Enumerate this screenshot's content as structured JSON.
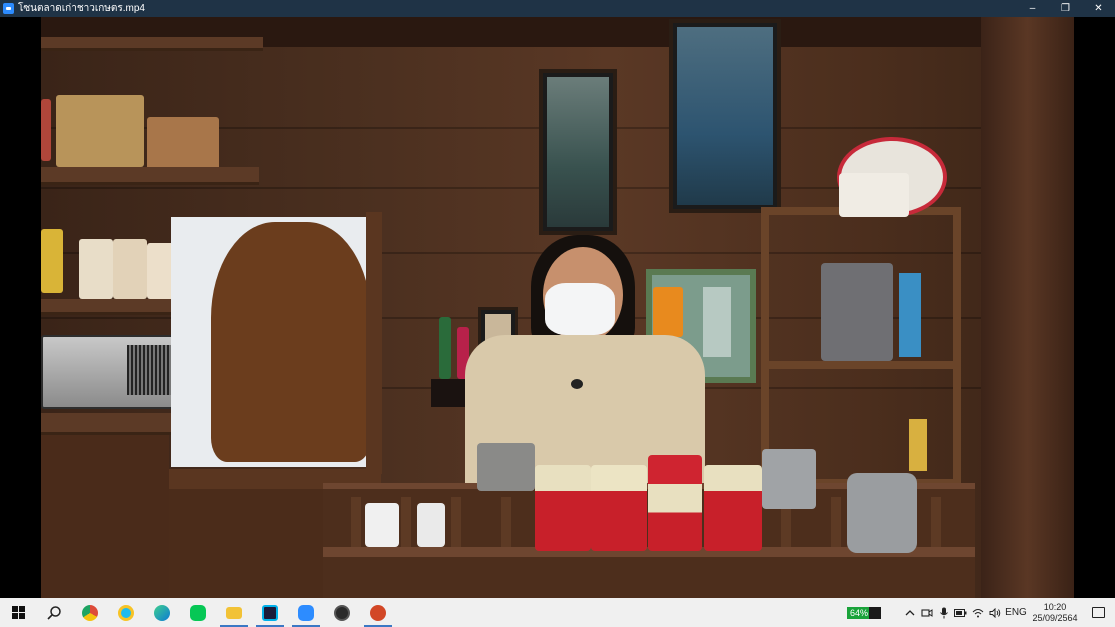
{
  "window": {
    "title": "โซนตลาดเก่าชาวเกษตร.mp4",
    "minimize_glyph": "–",
    "restore_glyph": "❐",
    "close_glyph": "✕"
  },
  "taskbar": {
    "apps": [
      {
        "name": "search-icon"
      },
      {
        "name": "chrome-icon",
        "color": "#dd4b39"
      },
      {
        "name": "internet-explorer-icon",
        "color": "#1ebbee"
      },
      {
        "name": "edge-icon",
        "color": "#0c7bd4"
      },
      {
        "name": "line-icon",
        "color": "#06c755"
      },
      {
        "name": "file-explorer-icon",
        "color": "#f2c236"
      },
      {
        "name": "webex-icon",
        "color": "#1a1a3a"
      },
      {
        "name": "zoom-icon",
        "color": "#2d8cff"
      },
      {
        "name": "obs-icon",
        "color": "#2b2b2b"
      },
      {
        "name": "powerpoint-icon",
        "color": "#d24726"
      }
    ],
    "battery_percent_label": "64%",
    "battery_level": 0.64,
    "language": "ENG",
    "time": "10:20",
    "date": "25/09/2564"
  },
  "colors": {
    "titlebar": "#1f3346",
    "taskbar": "#f0f0f0",
    "accent": "#3b78c4"
  }
}
